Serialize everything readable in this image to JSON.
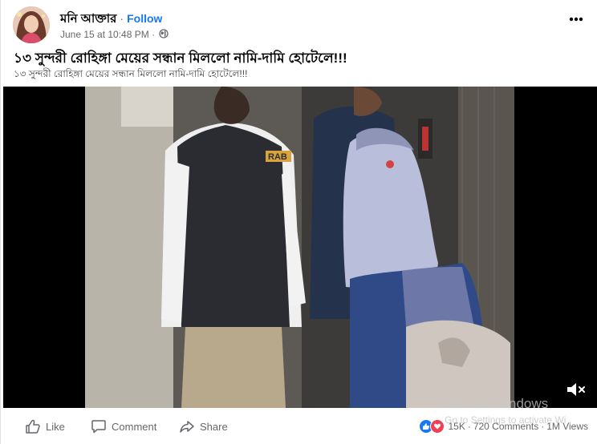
{
  "post": {
    "author": "মনি আক্তার",
    "separator": "·",
    "follow_label": "Follow",
    "timestamp": "June 15 at 10:48 PM",
    "meta_separator": "·",
    "audience_icon": "globe-icon",
    "more_icon": "more-options-icon",
    "title": "১৩ সুন্দরী রোহিঙ্গা মেয়ের সন্ধান মিললো নামি-দামি হোটেলে!!!",
    "body": "১৩ সুন্দরী রোহিঙ্গা মেয়ের সন্ধান মিললো নামি-দামি হোটেলে!!!"
  },
  "video": {
    "badge_text": "RAB",
    "mute_icon": "volume-muted-icon"
  },
  "actions": {
    "like_label": "Like",
    "comment_label": "Comment",
    "share_label": "Share"
  },
  "stats": {
    "reactions_count": "15K",
    "comments": "720 Comments",
    "views": "1M Views",
    "sep": "·"
  },
  "overlay": {
    "watermark_title": "Activate Windows",
    "watermark_sub": "Go to Settings to activate Wi"
  },
  "colors": {
    "accent": "#1877f2",
    "secondary_text": "#65676b",
    "like_blue": "#1877f2",
    "love_red": "#f33e58"
  }
}
